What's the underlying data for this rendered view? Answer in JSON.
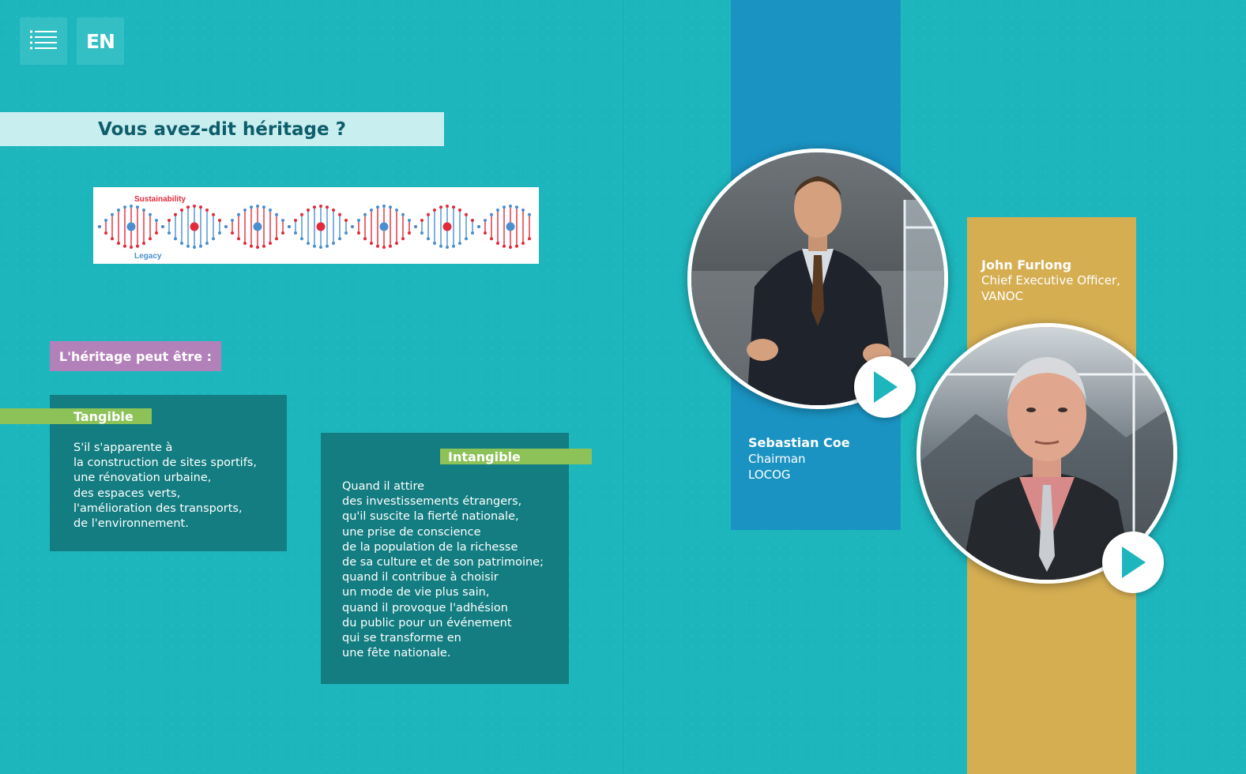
{
  "header": {
    "menu_icon": "list-icon",
    "language_label": "EN"
  },
  "page_title": "Vous avez-dit héritage ?",
  "dna_graphic": {
    "top_label": "Sustainability",
    "bottom_label": "Legacy",
    "colors": {
      "red": "#e22b3a",
      "blue": "#4a90cf"
    }
  },
  "heritage_label": "L'héritage peut être :",
  "cards": {
    "tangible": {
      "title": "Tangible",
      "text": "S'il s'apparente à\nla construction de sites sportifs,\nune rénovation urbaine,\ndes espaces verts,\nl'amélioration des transports,\nde l'environnement."
    },
    "intangible": {
      "title": "Intangible",
      "text": "Quand il attire\ndes investissements étrangers,\nqu'il suscite la fierté nationale,\nune prise de conscience\nde la population de la richesse\nde sa culture et de son patrimoine;\nquand il contribue à choisir\nun mode de vie plus sain,\nquand il provoque l'adhésion\ndu public pour un événement\nqui se transforme en\nune fête nationale."
    }
  },
  "speakers": [
    {
      "name": "Sebastian Coe",
      "role": "Chairman\nLOCOG",
      "play_icon": "play-icon",
      "strip_color": "#1a93c2"
    },
    {
      "name": "John Furlong",
      "role": "Chief Executive Officer,\nVANOC",
      "play_icon": "play-icon",
      "strip_color": "#d5ae52"
    }
  ],
  "colors": {
    "background": "#1db6bd",
    "card": "#137d81",
    "green_tag": "#8cc257",
    "purple_label": "#b381b9",
    "title_bar": "#c9eef0",
    "title_text": "#0d5e6a",
    "play_arrow": "#1db6bd"
  }
}
